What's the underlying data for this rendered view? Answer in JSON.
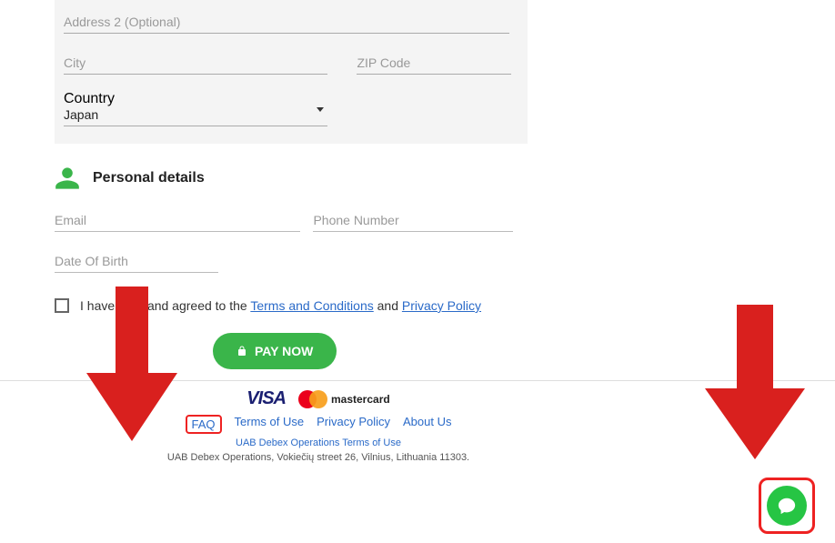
{
  "billing": {
    "address2_placeholder": "Address 2 (Optional)",
    "city_placeholder": "City",
    "zip_placeholder": "ZIP Code",
    "country_label": "Country",
    "country_value": "Japan"
  },
  "personal": {
    "heading": "Personal details",
    "email_placeholder": "Email",
    "phone_placeholder": "Phone Number",
    "dob_placeholder": "Date Of Birth"
  },
  "consent": {
    "text_prefix": "I have read and agreed to the ",
    "terms_link": "Terms and Conditions",
    "text_mid": " and ",
    "privacy_link": "Privacy Policy"
  },
  "pay_button": "PAY NOW",
  "cards": {
    "visa": "VISA",
    "mastercard": "mastercard"
  },
  "footer": {
    "faq": "FAQ",
    "terms": "Terms of Use",
    "privacy": "Privacy Policy",
    "about": "About Us",
    "sub_terms": "UAB Debex Operations Terms of Use",
    "address": "UAB Debex Operations, Vokiečių street 26, Vilnius, Lithuania 11303."
  }
}
